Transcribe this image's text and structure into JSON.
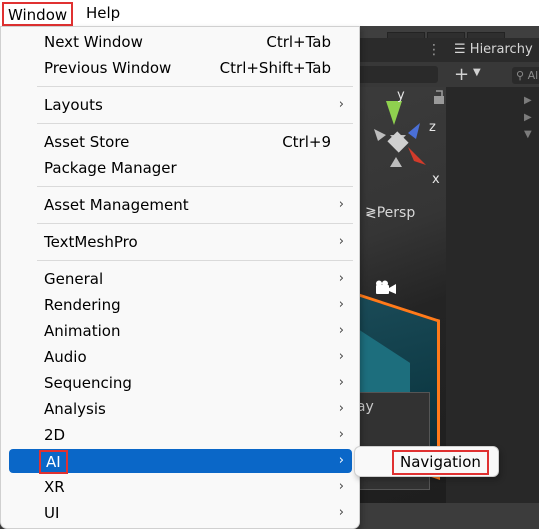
{
  "menubar": {
    "window_label": "Window",
    "help_label": "Help"
  },
  "menu": {
    "items": [
      {
        "label": "Next Window",
        "shortcut": "Ctrl+Tab"
      },
      {
        "label": "Previous Window",
        "shortcut": "Ctrl+Shift+Tab"
      },
      {
        "label": "Layouts",
        "arrow": "›"
      },
      {
        "label": "Asset Store",
        "shortcut": "Ctrl+9"
      },
      {
        "label": "Package Manager"
      },
      {
        "label": "Asset Management",
        "arrow": "›"
      },
      {
        "label": "TextMeshPro",
        "arrow": "›"
      },
      {
        "label": "General",
        "arrow": "›"
      },
      {
        "label": "Rendering",
        "arrow": "›"
      },
      {
        "label": "Animation",
        "arrow": "›"
      },
      {
        "label": "Audio",
        "arrow": "›"
      },
      {
        "label": "Sequencing",
        "arrow": "›"
      },
      {
        "label": "Analysis",
        "arrow": "›"
      },
      {
        "label": "2D",
        "arrow": "›"
      },
      {
        "label": "AI",
        "arrow": "›",
        "highlighted": true
      },
      {
        "label": "XR",
        "arrow": "›"
      },
      {
        "label": "UI",
        "arrow": "›"
      }
    ]
  },
  "submenu": {
    "item": "Navigation"
  },
  "editor": {
    "hierarchy_tab": "Hierarchy",
    "hierarchy_search_placeholder": "All",
    "persp_label": "Persp",
    "play_panel_label": "lay",
    "gizmo_axes": {
      "x": "x",
      "y": "y",
      "z": "z"
    },
    "add_symbol": "+",
    "caret_symbol": "▼"
  },
  "colors": {
    "highlight": "#0a67c8",
    "annotation_box": "#e03131",
    "terrain_border": "#ff7a1a"
  }
}
